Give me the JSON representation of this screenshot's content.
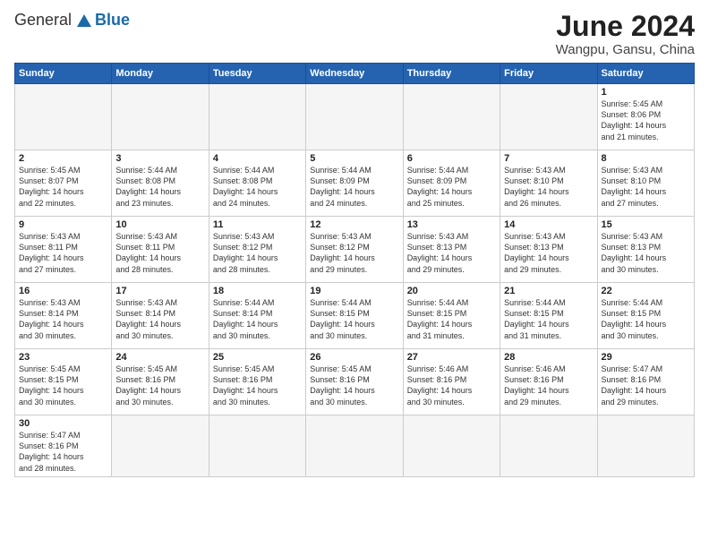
{
  "header": {
    "logo_general": "General",
    "logo_blue": "Blue",
    "month": "June 2024",
    "location": "Wangpu, Gansu, China"
  },
  "days_of_week": [
    "Sunday",
    "Monday",
    "Tuesday",
    "Wednesday",
    "Thursday",
    "Friday",
    "Saturday"
  ],
  "weeks": [
    [
      {
        "day": null,
        "info": ""
      },
      {
        "day": null,
        "info": ""
      },
      {
        "day": null,
        "info": ""
      },
      {
        "day": null,
        "info": ""
      },
      {
        "day": null,
        "info": ""
      },
      {
        "day": null,
        "info": ""
      },
      {
        "day": "1",
        "info": "Sunrise: 5:45 AM\nSunset: 8:06 PM\nDaylight: 14 hours\nand 21 minutes."
      }
    ],
    [
      {
        "day": "2",
        "info": "Sunrise: 5:45 AM\nSunset: 8:07 PM\nDaylight: 14 hours\nand 22 minutes."
      },
      {
        "day": "3",
        "info": "Sunrise: 5:44 AM\nSunset: 8:08 PM\nDaylight: 14 hours\nand 23 minutes."
      },
      {
        "day": "4",
        "info": "Sunrise: 5:44 AM\nSunset: 8:08 PM\nDaylight: 14 hours\nand 24 minutes."
      },
      {
        "day": "5",
        "info": "Sunrise: 5:44 AM\nSunset: 8:09 PM\nDaylight: 14 hours\nand 24 minutes."
      },
      {
        "day": "6",
        "info": "Sunrise: 5:44 AM\nSunset: 8:09 PM\nDaylight: 14 hours\nand 25 minutes."
      },
      {
        "day": "7",
        "info": "Sunrise: 5:43 AM\nSunset: 8:10 PM\nDaylight: 14 hours\nand 26 minutes."
      },
      {
        "day": "8",
        "info": "Sunrise: 5:43 AM\nSunset: 8:10 PM\nDaylight: 14 hours\nand 27 minutes."
      }
    ],
    [
      {
        "day": "9",
        "info": "Sunrise: 5:43 AM\nSunset: 8:11 PM\nDaylight: 14 hours\nand 27 minutes."
      },
      {
        "day": "10",
        "info": "Sunrise: 5:43 AM\nSunset: 8:11 PM\nDaylight: 14 hours\nand 28 minutes."
      },
      {
        "day": "11",
        "info": "Sunrise: 5:43 AM\nSunset: 8:12 PM\nDaylight: 14 hours\nand 28 minutes."
      },
      {
        "day": "12",
        "info": "Sunrise: 5:43 AM\nSunset: 8:12 PM\nDaylight: 14 hours\nand 29 minutes."
      },
      {
        "day": "13",
        "info": "Sunrise: 5:43 AM\nSunset: 8:13 PM\nDaylight: 14 hours\nand 29 minutes."
      },
      {
        "day": "14",
        "info": "Sunrise: 5:43 AM\nSunset: 8:13 PM\nDaylight: 14 hours\nand 29 minutes."
      },
      {
        "day": "15",
        "info": "Sunrise: 5:43 AM\nSunset: 8:13 PM\nDaylight: 14 hours\nand 30 minutes."
      }
    ],
    [
      {
        "day": "16",
        "info": "Sunrise: 5:43 AM\nSunset: 8:14 PM\nDaylight: 14 hours\nand 30 minutes."
      },
      {
        "day": "17",
        "info": "Sunrise: 5:43 AM\nSunset: 8:14 PM\nDaylight: 14 hours\nand 30 minutes."
      },
      {
        "day": "18",
        "info": "Sunrise: 5:44 AM\nSunset: 8:14 PM\nDaylight: 14 hours\nand 30 minutes."
      },
      {
        "day": "19",
        "info": "Sunrise: 5:44 AM\nSunset: 8:15 PM\nDaylight: 14 hours\nand 30 minutes."
      },
      {
        "day": "20",
        "info": "Sunrise: 5:44 AM\nSunset: 8:15 PM\nDaylight: 14 hours\nand 31 minutes."
      },
      {
        "day": "21",
        "info": "Sunrise: 5:44 AM\nSunset: 8:15 PM\nDaylight: 14 hours\nand 31 minutes."
      },
      {
        "day": "22",
        "info": "Sunrise: 5:44 AM\nSunset: 8:15 PM\nDaylight: 14 hours\nand 30 minutes."
      }
    ],
    [
      {
        "day": "23",
        "info": "Sunrise: 5:45 AM\nSunset: 8:15 PM\nDaylight: 14 hours\nand 30 minutes."
      },
      {
        "day": "24",
        "info": "Sunrise: 5:45 AM\nSunset: 8:16 PM\nDaylight: 14 hours\nand 30 minutes."
      },
      {
        "day": "25",
        "info": "Sunrise: 5:45 AM\nSunset: 8:16 PM\nDaylight: 14 hours\nand 30 minutes."
      },
      {
        "day": "26",
        "info": "Sunrise: 5:45 AM\nSunset: 8:16 PM\nDaylight: 14 hours\nand 30 minutes."
      },
      {
        "day": "27",
        "info": "Sunrise: 5:46 AM\nSunset: 8:16 PM\nDaylight: 14 hours\nand 30 minutes."
      },
      {
        "day": "28",
        "info": "Sunrise: 5:46 AM\nSunset: 8:16 PM\nDaylight: 14 hours\nand 29 minutes."
      },
      {
        "day": "29",
        "info": "Sunrise: 5:47 AM\nSunset: 8:16 PM\nDaylight: 14 hours\nand 29 minutes."
      }
    ],
    [
      {
        "day": "30",
        "info": "Sunrise: 5:47 AM\nSunset: 8:16 PM\nDaylight: 14 hours\nand 28 minutes."
      },
      {
        "day": null,
        "info": ""
      },
      {
        "day": null,
        "info": ""
      },
      {
        "day": null,
        "info": ""
      },
      {
        "day": null,
        "info": ""
      },
      {
        "day": null,
        "info": ""
      },
      {
        "day": null,
        "info": ""
      }
    ]
  ]
}
